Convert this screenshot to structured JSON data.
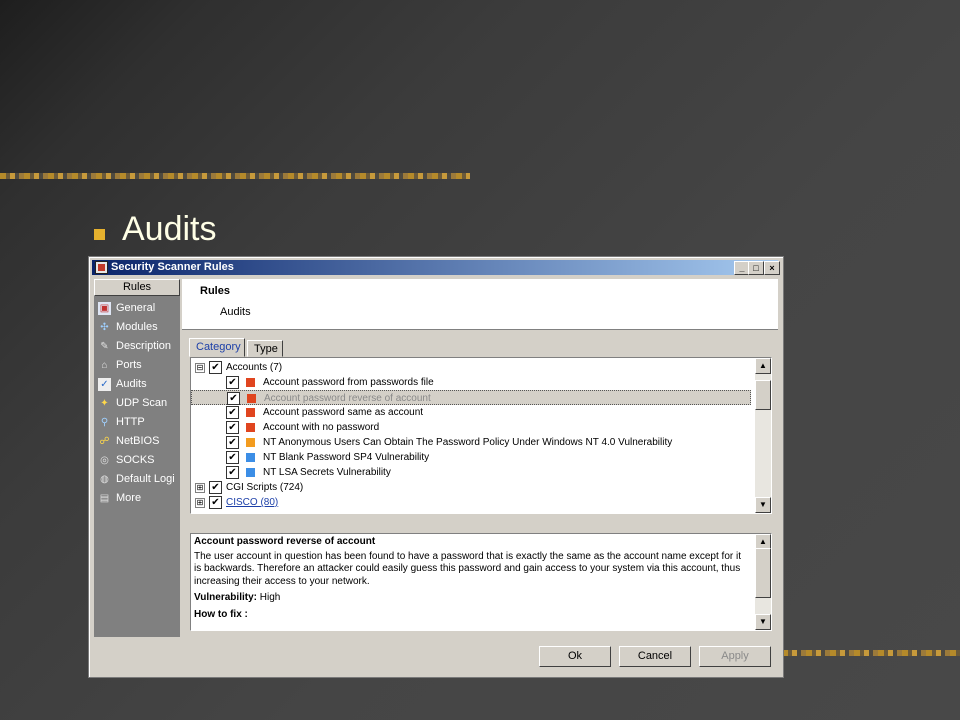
{
  "slide": {
    "bullet_title": "Audits"
  },
  "window": {
    "title": "Security Scanner Rules",
    "min": "_",
    "max": "□",
    "close": "×"
  },
  "sidebar": {
    "header": "Rules",
    "items": [
      {
        "label": "General",
        "icon": "general-icon"
      },
      {
        "label": "Modules",
        "icon": "modules-icon"
      },
      {
        "label": "Description",
        "icon": "description-icon"
      },
      {
        "label": "Ports",
        "icon": "ports-icon"
      },
      {
        "label": "Audits",
        "icon": "audits-icon"
      },
      {
        "label": "UDP Scan",
        "icon": "udp-scan-icon"
      },
      {
        "label": "HTTP",
        "icon": "http-icon"
      },
      {
        "label": "NetBIOS",
        "icon": "netbios-icon"
      },
      {
        "label": "SOCKS",
        "icon": "socks-icon"
      },
      {
        "label": "Default Logi",
        "icon": "default-login-icon"
      },
      {
        "label": "More",
        "icon": "more-icon"
      }
    ]
  },
  "header": {
    "title": "Rules",
    "subtitle": "Audits"
  },
  "tabs": [
    {
      "label": "Category"
    },
    {
      "label": "Type"
    }
  ],
  "tree": [
    {
      "label": "Accounts (7)",
      "expander": "⊟",
      "checked": "✔"
    },
    {
      "label": "Account password from passwords file",
      "checked": "✔",
      "severity": "red"
    },
    {
      "label": "Account password reverse of account",
      "checked": "✔",
      "severity": "red"
    },
    {
      "label": "Account password same as account",
      "checked": "✔",
      "severity": "red"
    },
    {
      "label": "Account with no password",
      "checked": "✔",
      "severity": "red"
    },
    {
      "label": "NT Anonymous Users Can Obtain The Password Policy Under Windows NT 4.0 Vulnerability",
      "checked": "✔",
      "severity": "orange"
    },
    {
      "label": "NT Blank Password SP4 Vulnerability",
      "checked": "✔",
      "severity": "blue"
    },
    {
      "label": "NT LSA Secrets Vulnerability",
      "checked": "✔",
      "severity": "blue"
    },
    {
      "label": "CGI Scripts (724)",
      "expander": "⊞",
      "checked": "✔"
    },
    {
      "label": "CISCO (80)",
      "expander": "⊞",
      "checked": "✔"
    }
  ],
  "description": {
    "title": "Account password reverse of account",
    "body": "The user account in question has been found to have a password that is exactly the same as the account name except for it is backwards. Therefore an attacker could easily guess this password and gain access to your system via this account, thus increasing their access to your network.",
    "vulnerability_label": "Vulnerability:",
    "vulnerability_value": "High",
    "how_to_fix": "How to fix :"
  },
  "buttons": {
    "ok": "Ok",
    "cancel": "Cancel",
    "apply": "Apply"
  },
  "colors": {
    "titlebar_start": "#0a246a",
    "red": "#e0451f",
    "orange": "#f39c1f",
    "blue": "#3c8ee6"
  }
}
